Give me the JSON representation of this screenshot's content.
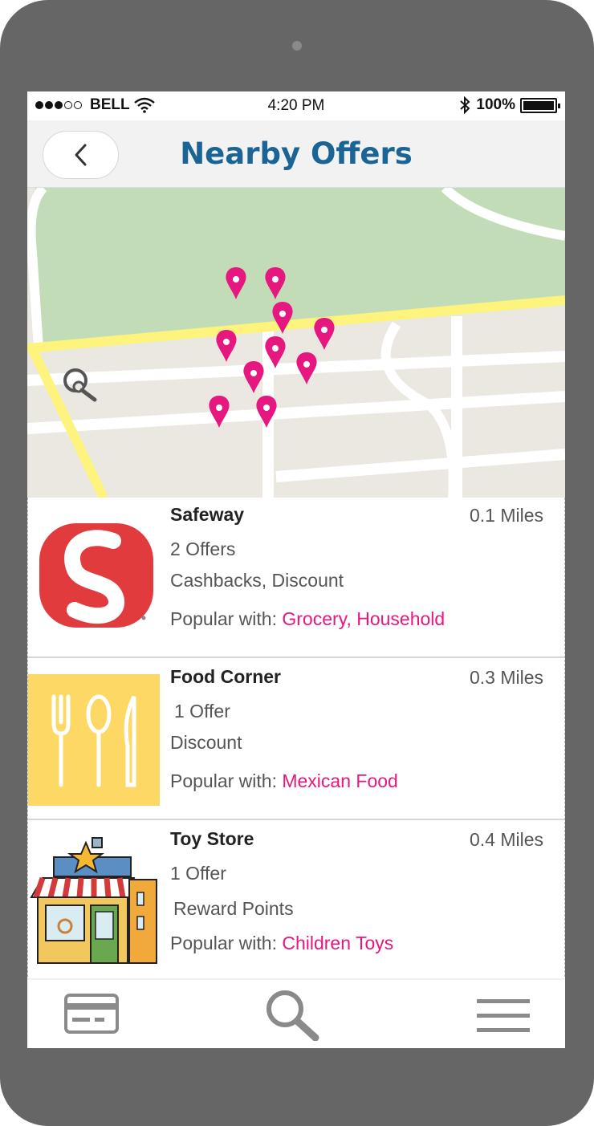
{
  "status_bar": {
    "signal_dots_filled": 3,
    "signal_dots_empty": 2,
    "carrier": "BELL",
    "time": "4:20 PM",
    "battery": "100%",
    "icons": [
      "wifi-icon",
      "bluetooth-icon",
      "battery-icon"
    ]
  },
  "header": {
    "title": "Nearby Offers",
    "back_icon": "chevron-left-icon"
  },
  "map": {
    "pin_count": 10,
    "pin_color": "#e6177e",
    "park_color": "#c2dcb8",
    "land_color": "#ebe8e2",
    "highway_color": "#fdf37d",
    "controls": [
      "search-location-icon"
    ]
  },
  "stores": [
    {
      "name": "Safeway",
      "distance": "0.1 Miles",
      "offers": "2 Offers",
      "types": "Cashbacks, Discount",
      "popular_label": "Popular with:",
      "popular_categories": "Grocery, Household",
      "logo": "safeway-logo"
    },
    {
      "name": "Food Corner",
      "distance": "0.3 Miles",
      "offers": "1 Offer",
      "types": "Discount",
      "popular_label": "Popular with:",
      "popular_categories": "Mexican Food",
      "logo": "utensils-logo"
    },
    {
      "name": "Toy Store",
      "distance": "0.4 Miles",
      "offers": "1 Offer",
      "types": "Reward Points",
      "popular_label": "Popular with:",
      "popular_categories": "Children Toys",
      "logo": "toy-store-illustration"
    }
  ],
  "bottom_nav": {
    "tabs": [
      "credit-card-icon",
      "search-icon",
      "menu-icon"
    ]
  },
  "colors": {
    "accent_title": "#1b6496",
    "category_pink": "#e6177e",
    "device_frame": "#666666"
  }
}
